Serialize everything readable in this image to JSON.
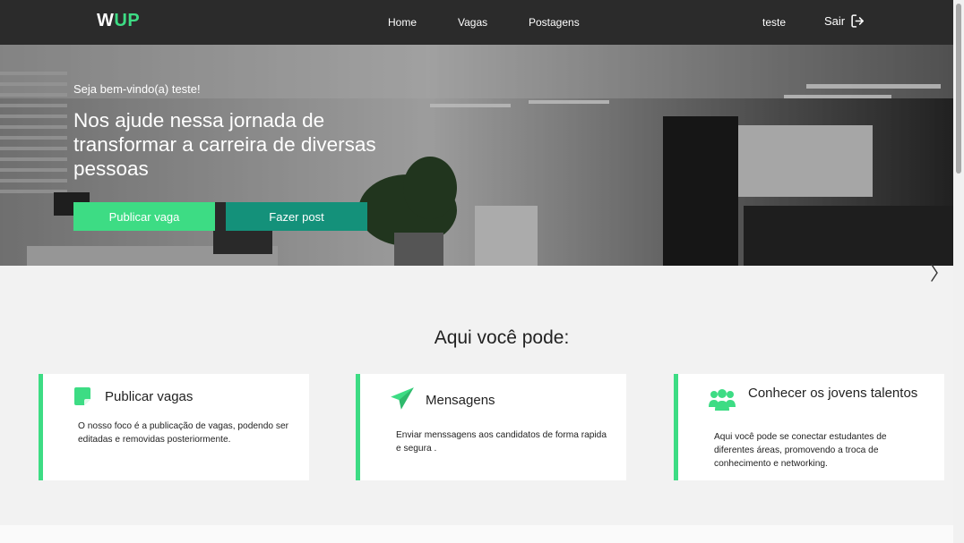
{
  "navbar": {
    "logo_w": "W",
    "logo_up": "UP",
    "links": [
      "Home",
      "Vagas",
      "Postagens"
    ],
    "user": "teste",
    "exit_label": "Sair",
    "exit_icon": "logout-icon"
  },
  "hero": {
    "welcome": "Seja bem-vindo(a) teste!",
    "title": "Nos ajude nessa jornada de transformar a carreira de diversas pessoas",
    "btn_publicar": "Publicar vaga",
    "btn_post": "Fazer post",
    "next_icon": "chevron-right-icon"
  },
  "section": {
    "title": "Aqui você pode:",
    "cards": [
      {
        "icon": "note-icon",
        "title": "Publicar vagas",
        "text": "O nosso foco é a publicação de vagas, podendo ser editadas e removidas posteriormente."
      },
      {
        "icon": "paper-plane-icon",
        "title": "Mensagens",
        "text": "Enviar menssagens aos candidatos de forma rapida e segura ."
      },
      {
        "icon": "users-icon",
        "title": "Conhecer os jovens talentos",
        "text": "Aqui você pode se conectar estudantes de diferentes áreas, promovendo a troca de conhecimento e networking."
      }
    ]
  },
  "colors": {
    "accent": "#3ddc84",
    "accent_dark": "#14917a",
    "navbar": "#2b2b2b"
  }
}
